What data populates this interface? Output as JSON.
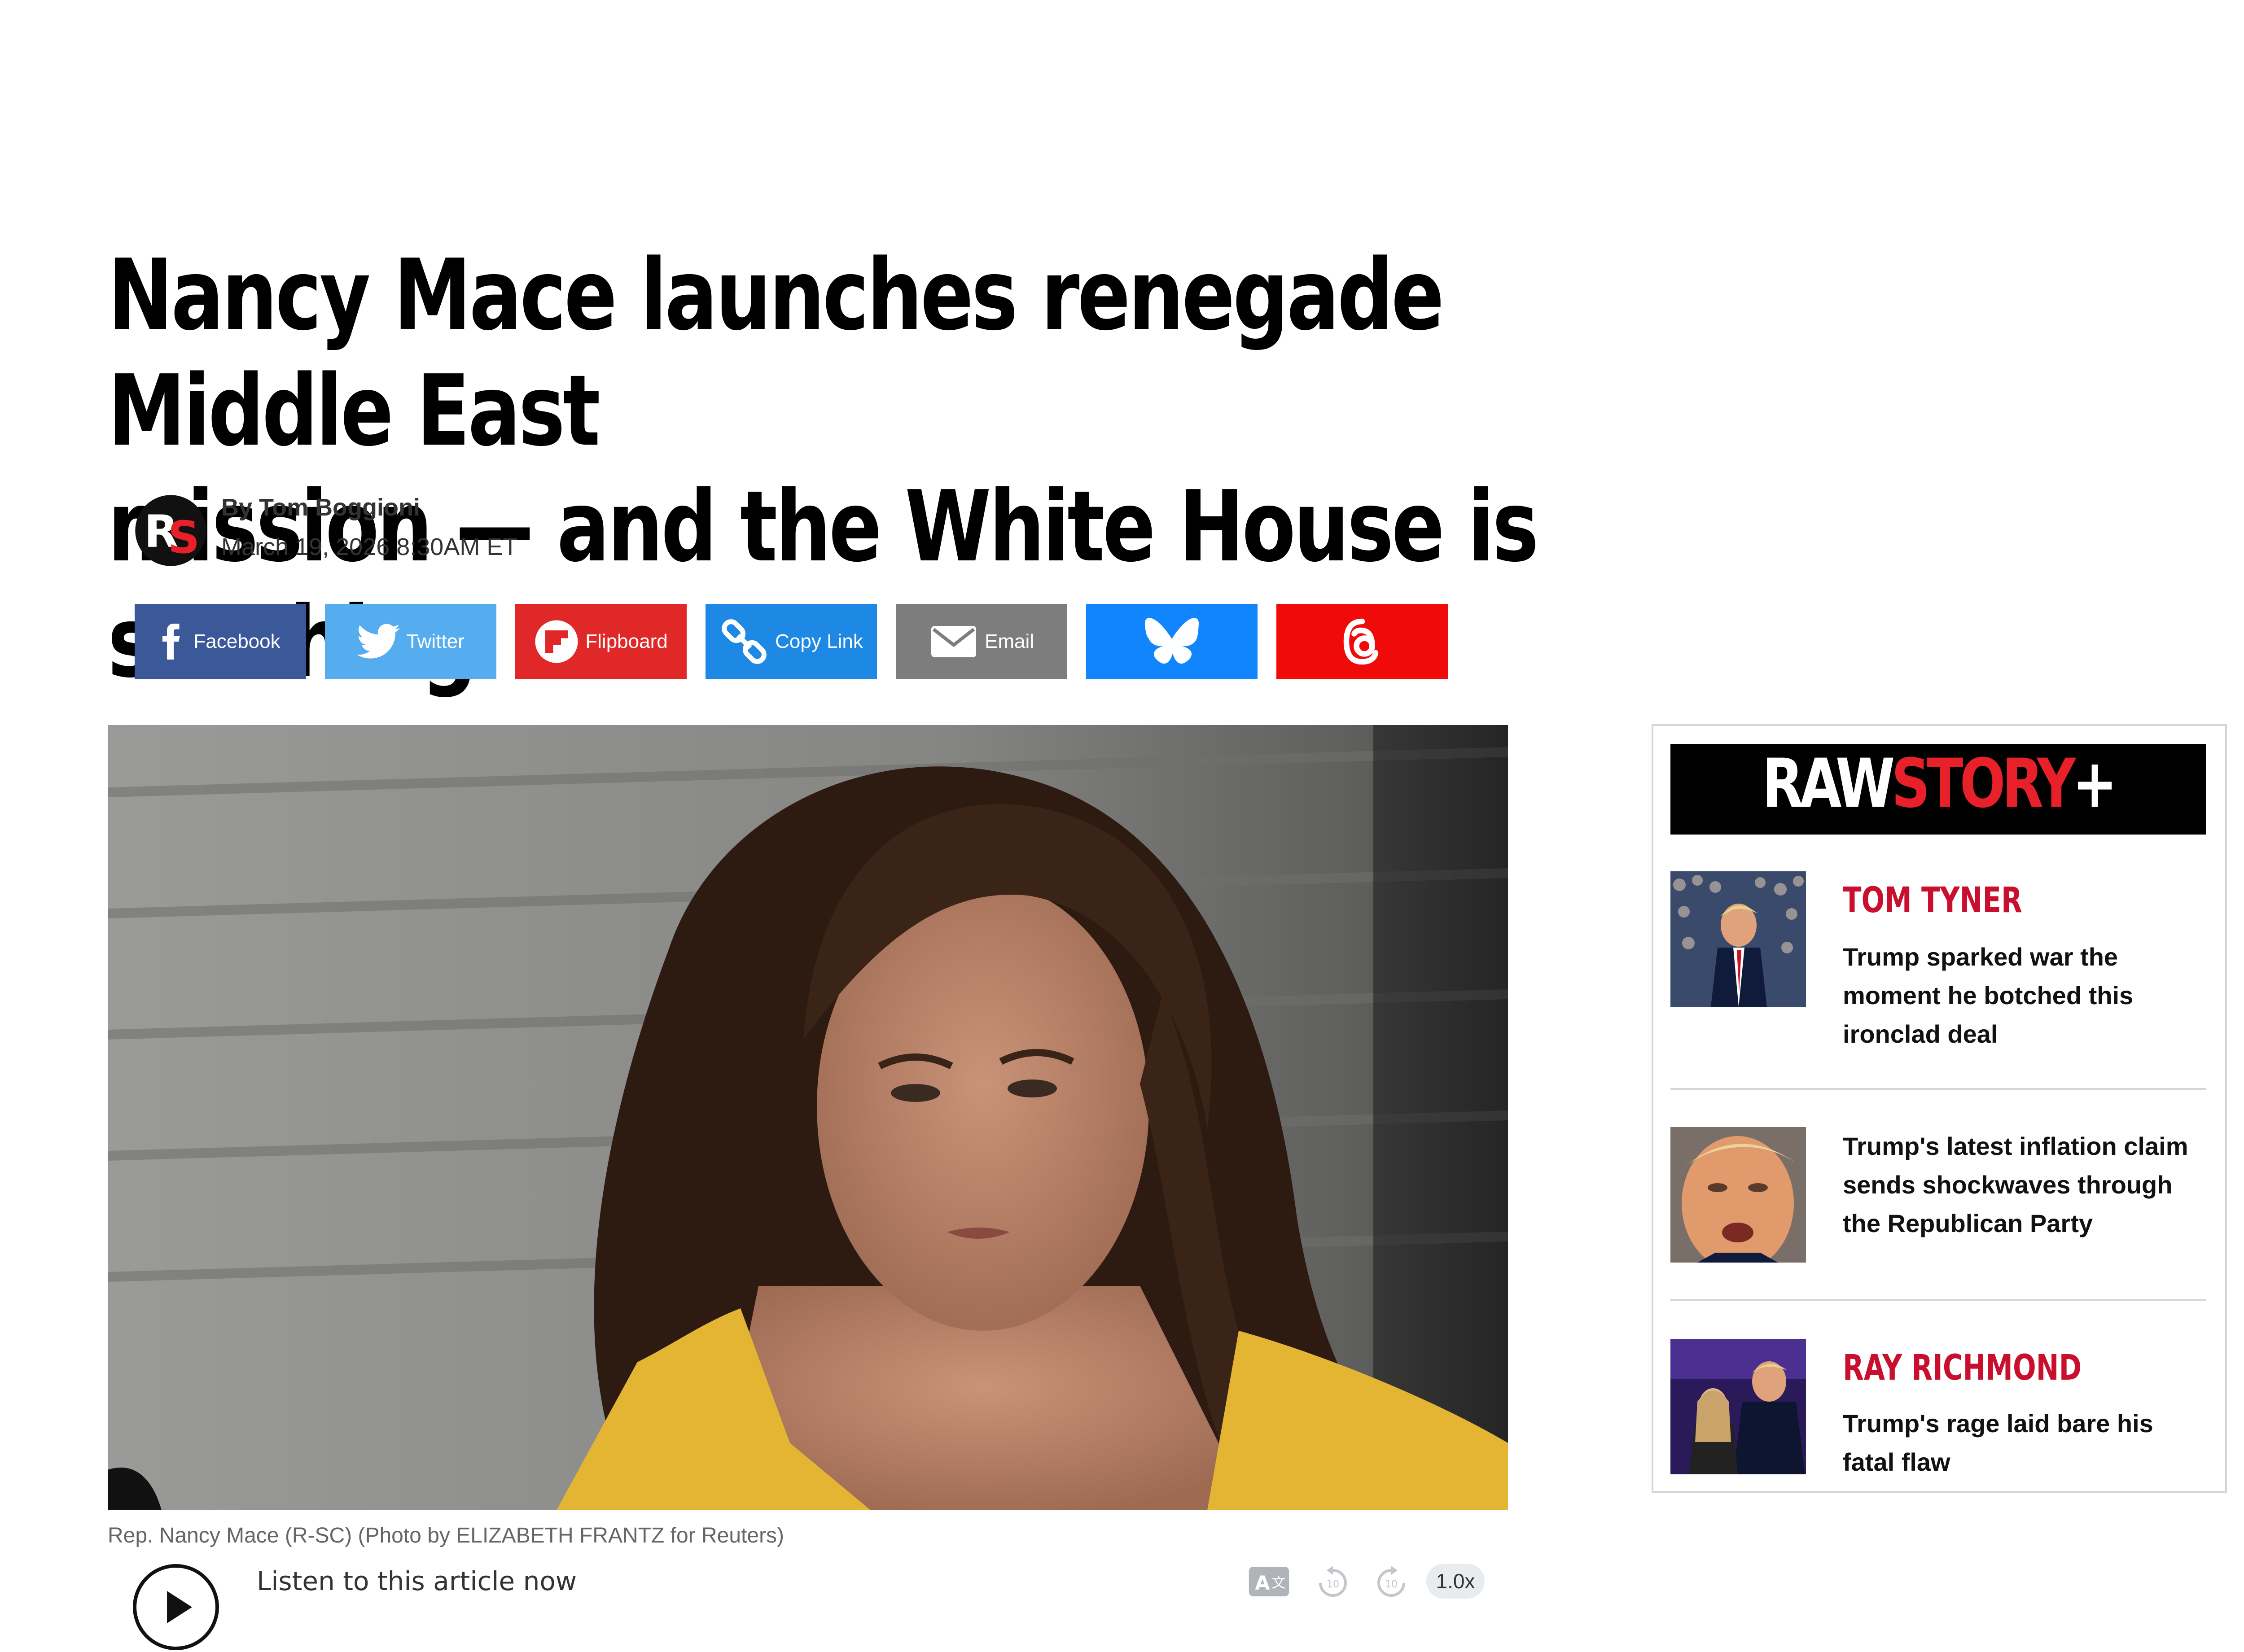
{
  "article": {
    "headline_line1": "Nancy Mace launches renegade Middle East",
    "headline_line2": "mission — and the White House is seething",
    "author": "By Tom Boggioni",
    "date": "March 19, 2026 8:30AM ET",
    "logo_letters": "RS",
    "image_caption": "Rep. Nancy Mace (R-SC) (Photo by ELIZABETH FRANTZ for Reuters)"
  },
  "share": {
    "buttons": [
      {
        "label": "Facebook",
        "icon": "facebook-icon",
        "color": "#3b5998"
      },
      {
        "label": "Twitter",
        "icon": "twitter-icon",
        "color": "#55acee"
      },
      {
        "label": "Flipboard",
        "icon": "flipboard-icon",
        "color": "#e12828"
      },
      {
        "label": "Copy Link",
        "icon": "link-icon",
        "color": "#1e88e5"
      },
      {
        "label": "Email",
        "icon": "email-icon",
        "color": "#7d7d7d"
      },
      {
        "label": "",
        "icon": "bluesky-icon",
        "color": "#1185fe"
      },
      {
        "label": "",
        "icon": "threads-icon",
        "color": "#f00a0a"
      }
    ]
  },
  "audio": {
    "listen_label": "Listen to this article now",
    "speed": "1.0x",
    "rewind": "10",
    "forward": "10"
  },
  "sidebar": {
    "brand_raw": "RAW",
    "brand_story": "STORY",
    "brand_plus": "+",
    "brand_accent": "#e8202a",
    "items": [
      {
        "author": "TOM TYNER",
        "title_lines": [
          "Trump sparked war the",
          "moment he botched this",
          "ironclad deal"
        ]
      },
      {
        "author": "",
        "title_lines": [
          "Trump's latest inflation claim",
          "sends shockwaves through",
          "the Republican Party"
        ]
      },
      {
        "author": "RAY RICHMOND",
        "title_lines": [
          "Trump's rage laid bare his",
          "fatal flaw"
        ]
      }
    ]
  },
  "colors": {
    "author_red": "#c8102e",
    "dress_yellow": "#e3b532"
  }
}
